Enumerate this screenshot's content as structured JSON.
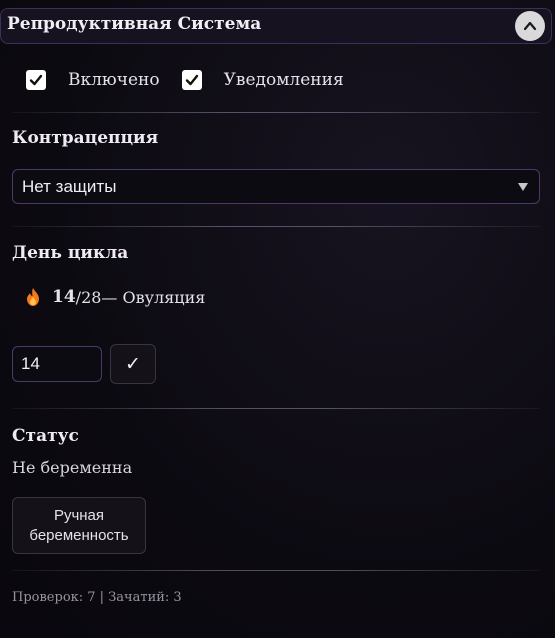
{
  "panel": {
    "title": "Репродуктивная Система",
    "collapse_icon": "chevron-up-icon"
  },
  "toggles": {
    "enabled_label": "Включено",
    "enabled_checked": true,
    "notifications_label": "Уведомления",
    "notifications_checked": true
  },
  "contraception": {
    "title": "Контрацепция",
    "selected": "Нет защиты"
  },
  "cycle": {
    "title": "День цикла",
    "icon": "fire-icon",
    "day": "14",
    "total": "/28",
    "phase": " — Овуляция",
    "input_value": "14",
    "confirm_label": "✓"
  },
  "status": {
    "title": "Статус",
    "value": "Не беременна",
    "manual_button": "Ручная беременность"
  },
  "footer": {
    "stats": "Проверок: 7 | Зачатий: 3"
  },
  "colors": {
    "accent_border": "#4a3a6a",
    "background": "#0b0910"
  }
}
